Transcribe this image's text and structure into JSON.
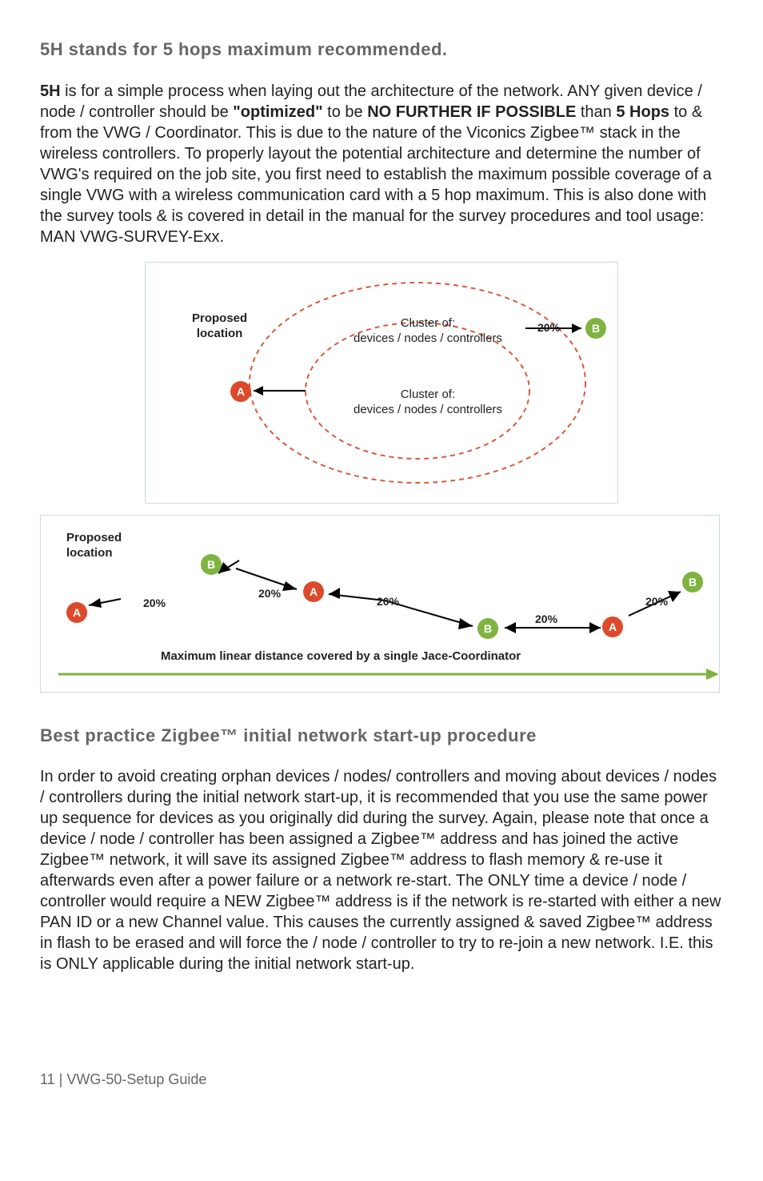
{
  "heading1": "5H stands for 5 hops maximum recommended.",
  "p1": {
    "s1a": "5H",
    "s1b": " is for a simple process when laying out the architecture of the network. ANY given device / node / controller should be ",
    "s2": "\"optimized\"",
    "s3": " to be ",
    "s4": "NO FURTHER IF POSSIBLE",
    "s5": " than ",
    "s6": "5 Hops",
    "s7": " to & from the VWG / Coordinator. This is due to the nature of the Viconics Zigbee™ stack in the wireless controllers. To properly layout the potential architecture and determine the number of VWG's required on the job site, you first need to establish the maximum possible coverage of a single VWG with a wireless communication card with a 5 hop maximum. This is also done with the survey tools & is covered in detail in the manual for the survey procedures and tool usage: MAN VWG-SURVEY-Exx."
  },
  "fig1": {
    "proposed_label1": "Proposed",
    "proposed_label2": "location",
    "cluster1a": "Cluster of:",
    "cluster1b": "devices / nodes / controllers",
    "cluster2a": "Cluster of:",
    "cluster2b": "devices / nodes / controllers",
    "pct": "20%",
    "markerA": "A",
    "markerB": "B"
  },
  "fig2": {
    "proposed_label1": "Proposed",
    "proposed_label2": "location",
    "pct": "20%",
    "markerA": "A",
    "markerB": "B",
    "caption": "Maximum linear distance covered by a single Jace-Coordinator"
  },
  "heading2": "Best practice Zigbee™ initial network start-up procedure",
  "p2": "In order to avoid creating orphan devices / nodes/ controllers and moving about devices / nodes / controllers during the initial network start-up, it is recommended that you use the same power up sequence for devices as you originally did during the survey. Again, please note that once a device / node / controller has been assigned a Zigbee™ address and has joined the active Zigbee™ network, it will save its assigned Zigbee™ address to flash memory & re-use it afterwards even after a power failure or a network re-start. The ONLY time a device / node / controller would require a NEW Zigbee™ address is if the network is re-started with either a new PAN ID or a new Channel value. This causes the currently assigned & saved Zigbee™ address in flash to be erased and will force the / node / controller to try to re-join a new network. I.E. this is ONLY applicable during the initial network start-up.",
  "footer": "11 | VWG-50-Setup Guide"
}
